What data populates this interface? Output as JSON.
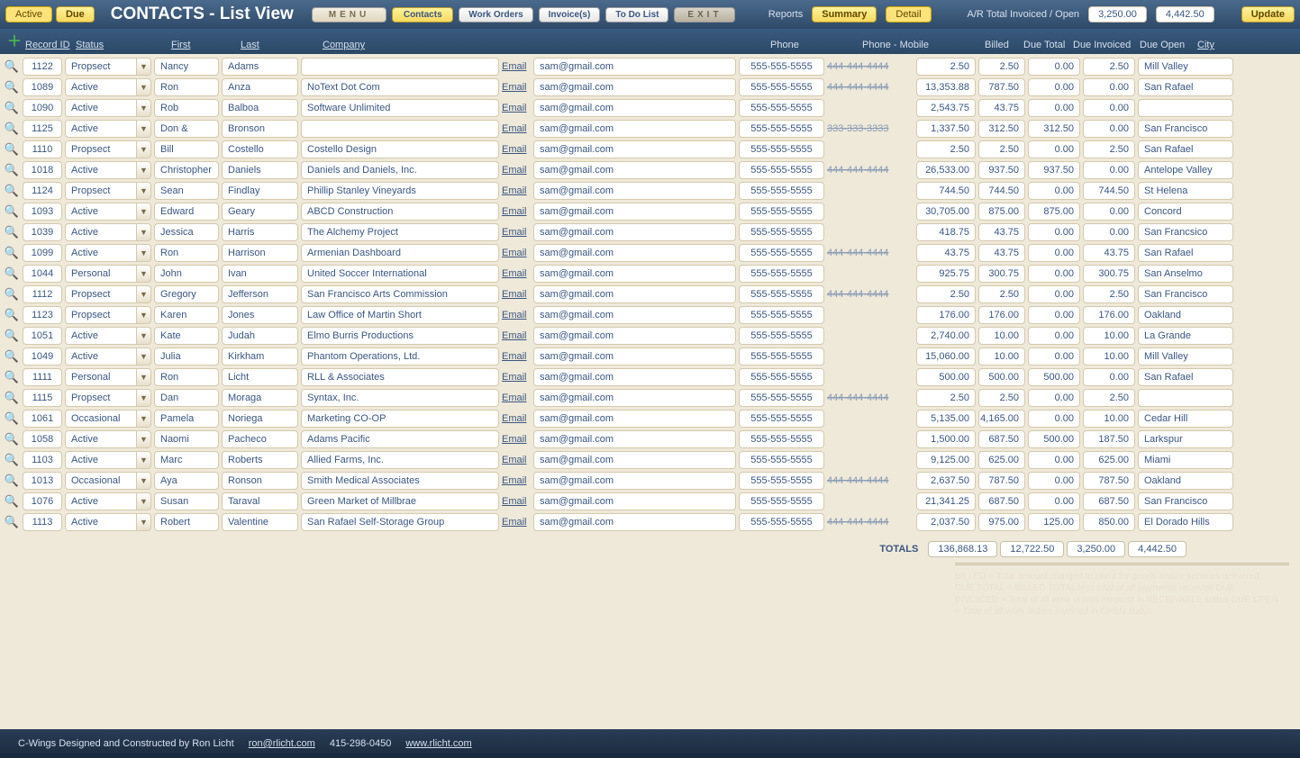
{
  "toolbar": {
    "active": "Active",
    "due": "Due",
    "title": "CONTACTS - List View",
    "menu": "MENU",
    "contacts": "Contacts",
    "workorders": "Work Orders",
    "invoices": "Invoice(s)",
    "todo": "To Do List",
    "exit": "EXIT",
    "reports": "Reports",
    "summary": "Summary",
    "detail": "Detail",
    "ar_label": "A/R Total  Invoiced / Open",
    "ar_inv": "3,250.00",
    "ar_open": "4,442.50",
    "update": "Update"
  },
  "headers": {
    "recid": "Record ID",
    "status": "Status",
    "first": "First",
    "last": "Last",
    "company": "Company",
    "phone": "Phone",
    "mobile": "Phone - Mobile",
    "billed": "Billed",
    "dtotal": "Due Total",
    "dinv": "Due Invoiced",
    "dopen": "Due Open",
    "city": "City"
  },
  "email_label": "Email",
  "rows": [
    {
      "id": "1122",
      "status": "Propsect",
      "first": "Nancy",
      "last": "Adams",
      "company": "",
      "email": "sam@gmail.com",
      "phone": "555-555-5555",
      "mobile": "444-444-4444",
      "billed": "2.50",
      "dtotal": "2.50",
      "dinv": "0.00",
      "dopen": "2.50",
      "city": "Mill Valley"
    },
    {
      "id": "1089",
      "status": "Active",
      "first": "Ron",
      "last": "Anza",
      "company": "NoText Dot Com",
      "email": "sam@gmail.com",
      "phone": "555-555-5555",
      "mobile": "444-444-4444",
      "billed": "13,353.88",
      "dtotal": "787.50",
      "dinv": "0.00",
      "dopen": "0.00",
      "city": "San Rafael"
    },
    {
      "id": "1090",
      "status": "Active",
      "first": "Rob",
      "last": "Balboa",
      "company": "Software Unlimited",
      "email": "sam@gmail.com",
      "phone": "555-555-5555",
      "mobile": "",
      "billed": "2,543.75",
      "dtotal": "43.75",
      "dinv": "0.00",
      "dopen": "0.00",
      "city": ""
    },
    {
      "id": "1125",
      "status": "Active",
      "first": "Don &",
      "last": "Bronson",
      "company": "",
      "email": "sam@gmail.com",
      "phone": "555-555-5555",
      "mobile": "333-333-3333",
      "billed": "1,337.50",
      "dtotal": "312.50",
      "dinv": "312.50",
      "dopen": "0.00",
      "city": "San Francisco"
    },
    {
      "id": "1110",
      "status": "Propsect",
      "first": "Bill",
      "last": "Costello",
      "company": "Costello Design",
      "email": "sam@gmail.com",
      "phone": "555-555-5555",
      "mobile": "",
      "billed": "2.50",
      "dtotal": "2.50",
      "dinv": "0.00",
      "dopen": "2.50",
      "city": "San Rafael"
    },
    {
      "id": "1018",
      "status": "Active",
      "first": "Christopher",
      "last": "Daniels",
      "company": "Daniels and Daniels, Inc.",
      "email": "sam@gmail.com",
      "phone": "555-555-5555",
      "mobile": "444-444-4444",
      "billed": "26,533.00",
      "dtotal": "937.50",
      "dinv": "937.50",
      "dopen": "0.00",
      "city": "Antelope Valley"
    },
    {
      "id": "1124",
      "status": "Propsect",
      "first": "Sean",
      "last": "Findlay",
      "company": "Phillip Stanley Vineyards",
      "email": "sam@gmail.com",
      "phone": "555-555-5555",
      "mobile": "",
      "billed": "744.50",
      "dtotal": "744.50",
      "dinv": "0.00",
      "dopen": "744.50",
      "city": "St Helena"
    },
    {
      "id": "1093",
      "status": "Active",
      "first": "Edward",
      "last": "Geary",
      "company": "ABCD Construction",
      "email": "sam@gmail.com",
      "phone": "555-555-5555",
      "mobile": "",
      "billed": "30,705.00",
      "dtotal": "875.00",
      "dinv": "875.00",
      "dopen": "0.00",
      "city": "Concord"
    },
    {
      "id": "1039",
      "status": "Active",
      "first": "Jessica",
      "last": "Harris",
      "company": "The Alchemy Project",
      "email": "sam@gmail.com",
      "phone": "555-555-5555",
      "mobile": "",
      "billed": "418.75",
      "dtotal": "43.75",
      "dinv": "0.00",
      "dopen": "0.00",
      "city": "San Francsico"
    },
    {
      "id": "1099",
      "status": "Active",
      "first": "Ron",
      "last": "Harrison",
      "company": "Armenian Dashboard",
      "email": "sam@gmail.com",
      "phone": "555-555-5555",
      "mobile": "444-444-4444",
      "billed": "43.75",
      "dtotal": "43.75",
      "dinv": "0.00",
      "dopen": "43.75",
      "city": "San Rafael"
    },
    {
      "id": "1044",
      "status": "Personal",
      "first": "John",
      "last": "Ivan",
      "company": "United Soccer International",
      "email": "sam@gmail.com",
      "phone": "555-555-5555",
      "mobile": "",
      "billed": "925.75",
      "dtotal": "300.75",
      "dinv": "0.00",
      "dopen": "300.75",
      "city": "San Anselmo"
    },
    {
      "id": "1112",
      "status": "Propsect",
      "first": "Gregory",
      "last": "Jefferson",
      "company": "San Francisco Arts Commission",
      "email": "sam@gmail.com",
      "phone": "555-555-5555",
      "mobile": "444-444-4444",
      "billed": "2.50",
      "dtotal": "2.50",
      "dinv": "0.00",
      "dopen": "2.50",
      "city": "San Francisco"
    },
    {
      "id": "1123",
      "status": "Propsect",
      "first": "Karen",
      "last": "Jones",
      "company": "Law Office of Martin Short",
      "email": "sam@gmail.com",
      "phone": "555-555-5555",
      "mobile": "",
      "billed": "176.00",
      "dtotal": "176.00",
      "dinv": "0.00",
      "dopen": "176.00",
      "city": "Oakland"
    },
    {
      "id": "1051",
      "status": "Active",
      "first": "Kate",
      "last": "Judah",
      "company": "Elmo Burris Productions",
      "email": "sam@gmail.com",
      "phone": "555-555-5555",
      "mobile": "",
      "billed": "2,740.00",
      "dtotal": "10.00",
      "dinv": "0.00",
      "dopen": "10.00",
      "city": "La Grande"
    },
    {
      "id": "1049",
      "status": "Active",
      "first": "Julia",
      "last": "Kirkham",
      "company": "Phantom Operations, Ltd.",
      "email": "sam@gmail.com",
      "phone": "555-555-5555",
      "mobile": "",
      "billed": "15,060.00",
      "dtotal": "10.00",
      "dinv": "0.00",
      "dopen": "10.00",
      "city": "Mill Valley"
    },
    {
      "id": "1111",
      "status": "Personal",
      "first": "Ron",
      "last": "Licht",
      "company": "RLL & Associates",
      "email": "sam@gmail.com",
      "phone": "555-555-5555",
      "mobile": "",
      "billed": "500.00",
      "dtotal": "500.00",
      "dinv": "500.00",
      "dopen": "0.00",
      "city": "San Rafael"
    },
    {
      "id": "1115",
      "status": "Propsect",
      "first": "Dan",
      "last": "Moraga",
      "company": "Syntax, Inc.",
      "email": "sam@gmail.com",
      "phone": "555-555-5555",
      "mobile": "444-444-4444",
      "billed": "2.50",
      "dtotal": "2.50",
      "dinv": "0.00",
      "dopen": "2.50",
      "city": ""
    },
    {
      "id": "1061",
      "status": "Occasional",
      "first": "Pamela",
      "last": "Noriega",
      "company": "Marketing CO-OP",
      "email": "sam@gmail.com",
      "phone": "555-555-5555",
      "mobile": "",
      "billed": "5,135.00",
      "dtotal": "4,165.00",
      "dinv": "0.00",
      "dopen": "10.00",
      "city": "Cedar Hill"
    },
    {
      "id": "1058",
      "status": "Active",
      "first": "Naomi",
      "last": "Pacheco",
      "company": "Adams Pacific",
      "email": "sam@gmail.com",
      "phone": "555-555-5555",
      "mobile": "",
      "billed": "1,500.00",
      "dtotal": "687.50",
      "dinv": "500.00",
      "dopen": "187.50",
      "city": "Larkspur"
    },
    {
      "id": "1103",
      "status": "Active",
      "first": "Marc",
      "last": "Roberts",
      "company": "Allied Farms, Inc.",
      "email": "sam@gmail.com",
      "phone": "555-555-5555",
      "mobile": "",
      "billed": "9,125.00",
      "dtotal": "625.00",
      "dinv": "0.00",
      "dopen": "625.00",
      "city": "Miami"
    },
    {
      "id": "1013",
      "status": "Occasional",
      "first": "Aya",
      "last": "Ronson",
      "company": "Smith Medical Associates",
      "email": "sam@gmail.com",
      "phone": "555-555-5555",
      "mobile": "444-444-4444",
      "billed": "2,637.50",
      "dtotal": "787.50",
      "dinv": "0.00",
      "dopen": "787.50",
      "city": "Oakland"
    },
    {
      "id": "1076",
      "status": "Active",
      "first": "Susan",
      "last": "Taraval",
      "company": "Green Market of Millbrae",
      "email": "sam@gmail.com",
      "phone": "555-555-5555",
      "mobile": "",
      "billed": "21,341.25",
      "dtotal": "687.50",
      "dinv": "0.00",
      "dopen": "687.50",
      "city": "San Francisco"
    },
    {
      "id": "1113",
      "status": "Active",
      "first": "Robert",
      "last": "Valentine",
      "company": "San Rafael Self-Storage Group",
      "email": "sam@gmail.com",
      "phone": "555-555-5555",
      "mobile": "444-444-4444",
      "billed": "2,037.50",
      "dtotal": "975.00",
      "dinv": "125.00",
      "dopen": "850.00",
      "city": "El Dorado Hills"
    }
  ],
  "totals": {
    "label": "TOTALS",
    "billed": "136,868.13",
    "dtotal": "12,722.50",
    "dinv": "3,250.00",
    "dopen": "4,442.50"
  },
  "help": "BILLED = Total amount charged to client for goods and/or services delivered\nDUE TOTAL = BILLED TOTAL less total of all payments received\nDUE INVOICED = Total of all work orders invoiced in RECEIVABLE status\nDUE OPEN = Total of all work orders invoiced in OPEN status",
  "footer": {
    "credit": "C-Wings Designed and Constructed by Ron Licht",
    "email": "ron@rlicht.com",
    "phone": "415-298-0450",
    "url": "www.rlicht.com"
  }
}
